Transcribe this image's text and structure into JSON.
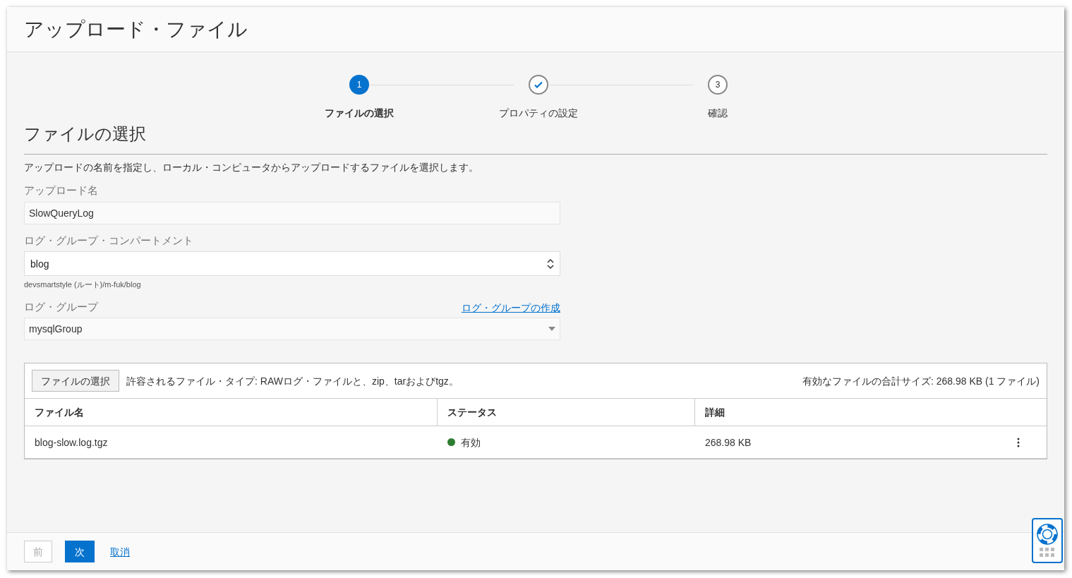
{
  "window": {
    "title": "アップロード・ファイル"
  },
  "steps": [
    {
      "number": "1",
      "label": "ファイルの選択",
      "selected": true,
      "completed": false
    },
    {
      "label": "プロパティの設定",
      "selected": false,
      "completed": true
    },
    {
      "number": "3",
      "label": "確認",
      "selected": false,
      "completed": false
    }
  ],
  "section": {
    "title": "ファイルの選択",
    "description": "アップロードの名前を指定し、ローカル・コンピュータからアップロードするファイルを選択します。"
  },
  "form": {
    "upload_name": {
      "label": "アップロード名",
      "value": "SlowQueryLog"
    },
    "compartment": {
      "label": "ログ・グループ・コンパートメント",
      "value": "blog",
      "hint": "devsmartstyle (ルート)/m-fuk/blog"
    },
    "log_group": {
      "label": "ログ・グループ",
      "link": "ログ・グループの作成",
      "value": "mysqlGroup"
    }
  },
  "files": {
    "select_button": "ファイルの選択",
    "allowed": "許容されるファイル・タイプ: RAWログ・ファイルと、zip、tarおよびtgz。",
    "total": "有効なファイルの合計サイズ: 268.98 KB (1 ファイル)",
    "columns": [
      "ファイル名",
      "ステータス",
      "詳細"
    ],
    "rows": [
      {
        "name": "blog-slow.log.tgz",
        "status": "有効",
        "color": "#2e7d32",
        "detail": "268.98 KB"
      }
    ]
  },
  "footer": {
    "buttons": [
      {
        "label": "前",
        "kind": "secondary",
        "disabled": true
      },
      {
        "label": "次",
        "kind": "primary",
        "disabled": false
      },
      {
        "label": "取消",
        "kind": "link",
        "disabled": false
      }
    ]
  }
}
